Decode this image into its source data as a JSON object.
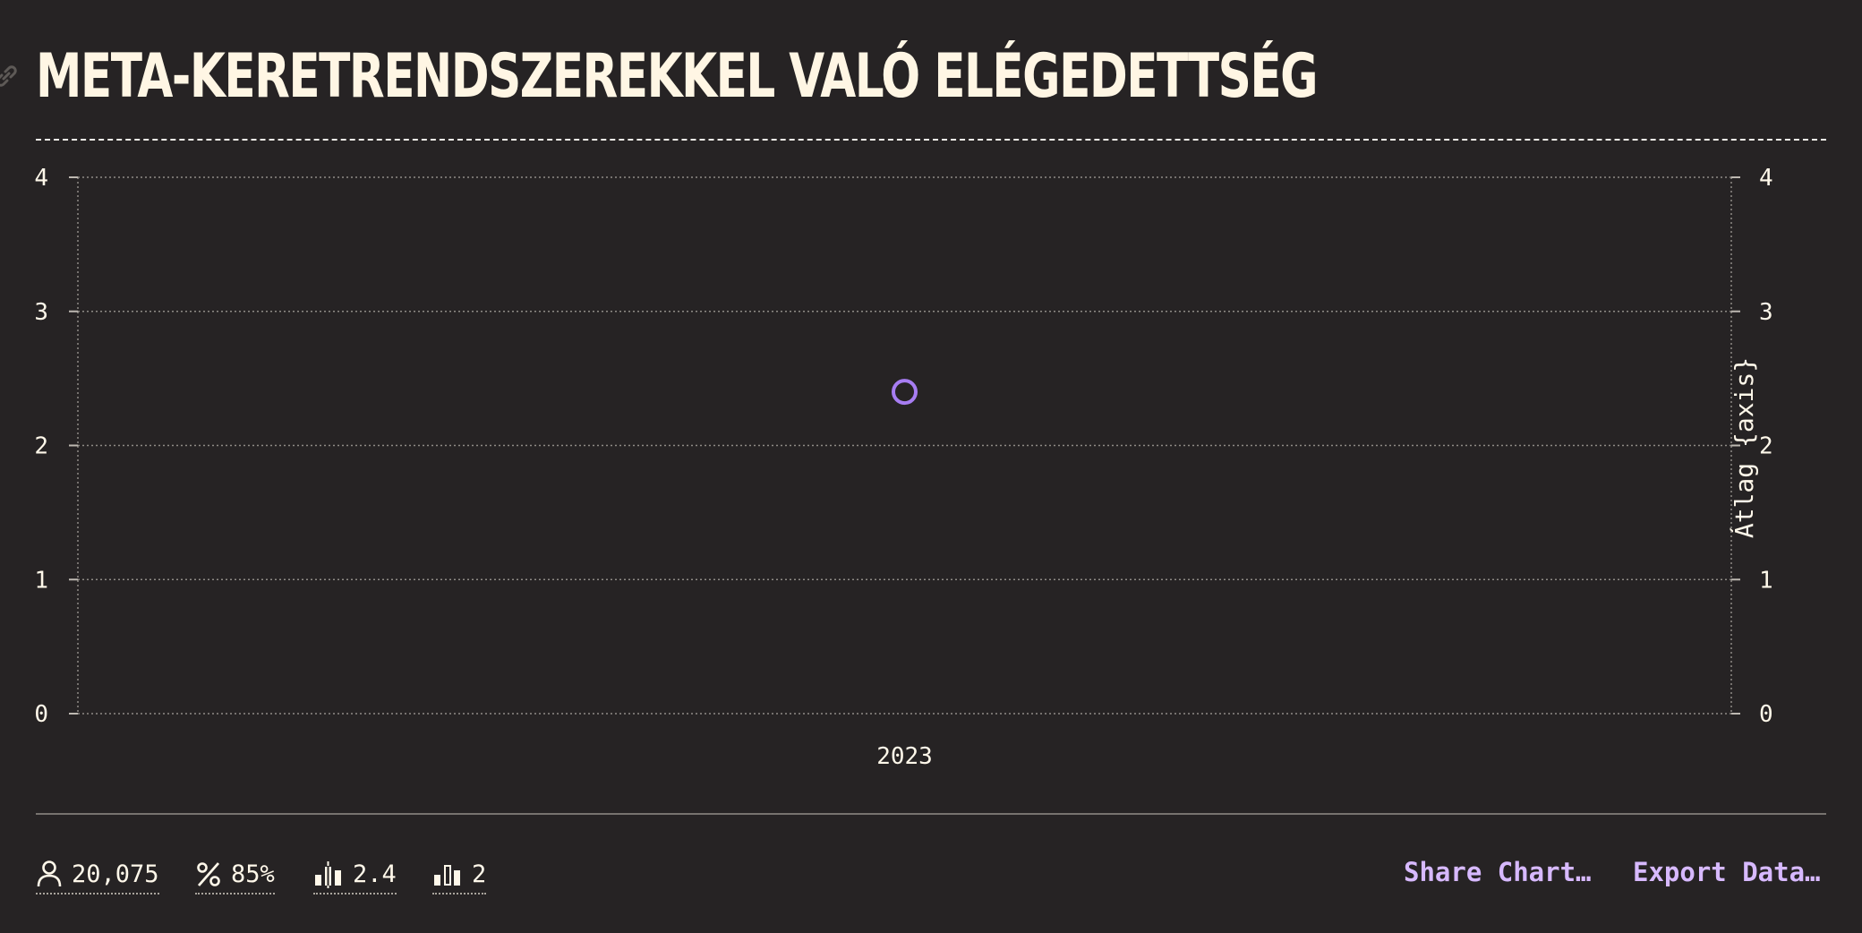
{
  "title": "META-KERETRENDSZEREKKEL VALÓ ELÉGEDETTSÉG",
  "colors": {
    "background": "#262324",
    "text": "#fff8ea",
    "accent": "#d7b9ff",
    "point": "#a77df2"
  },
  "chart_data": {
    "type": "scatter",
    "categories": [
      "2023"
    ],
    "series": [
      {
        "values": [
          2.4
        ]
      }
    ],
    "ylim": [
      0,
      4
    ],
    "yticks": [
      "0",
      "1",
      "2",
      "3",
      "4"
    ],
    "y2label": "Átlag {axis}",
    "grid": true
  },
  "stats": [
    {
      "icon": "user-icon",
      "value": "20,075"
    },
    {
      "icon": "percent-icon",
      "value": "85%"
    },
    {
      "icon": "average-bars-icon",
      "value": "2.4"
    },
    {
      "icon": "median-bars-icon",
      "value": "2"
    }
  ],
  "actions": {
    "share": "Share Chart…",
    "export": "Export Data…"
  }
}
